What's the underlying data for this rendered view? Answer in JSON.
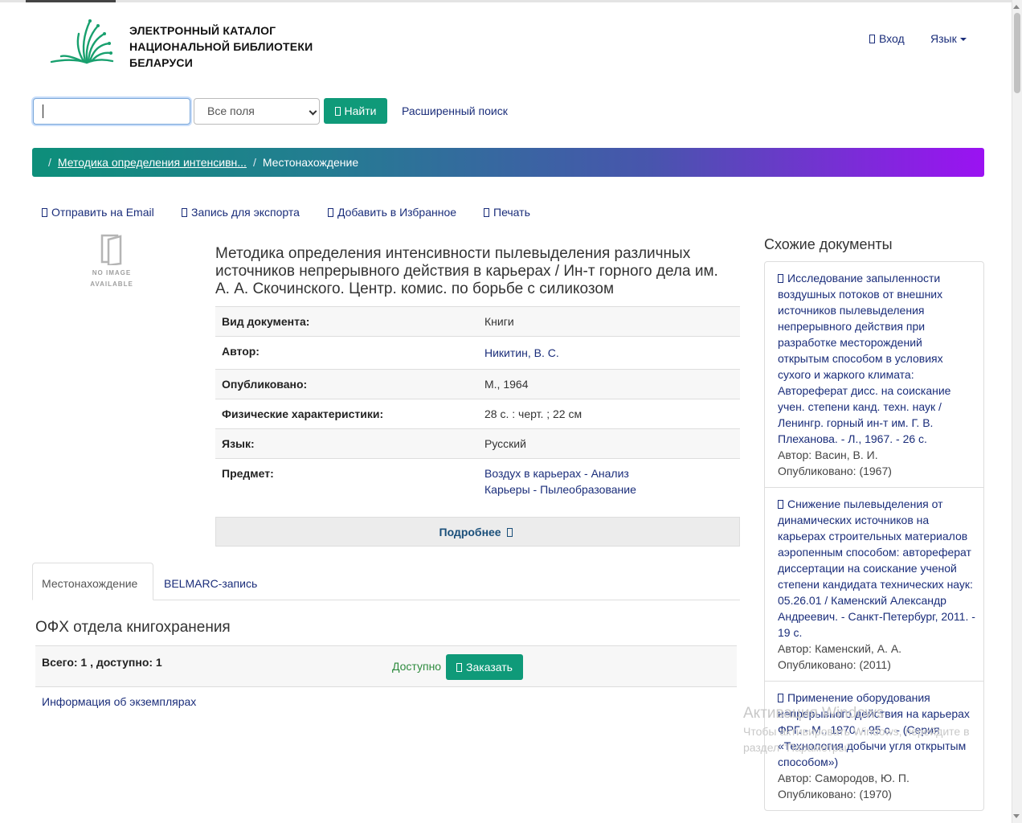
{
  "header": {
    "site_title_line1": "ЭЛЕКТРОННЫЙ КАТАЛОГ",
    "site_title_line2": "НАЦИОНАЛЬНОЙ БИБЛИОТЕКИ",
    "site_title_line3": "БЕЛАРУСИ",
    "login_label": "Вход",
    "language_label": "Язык"
  },
  "search": {
    "query": "",
    "field_select": "Все поля",
    "find_label": "Найти",
    "advanced_label": "Расширенный поиск"
  },
  "breadcrumb": {
    "record_link": "Методика определения интенсивн...",
    "current": "Местонахождение"
  },
  "actions": {
    "email": "Отправить на Email",
    "export": "Запись для экспорта",
    "favorites": "Добавить в Избранное",
    "print": "Печать"
  },
  "no_image": {
    "line1": "NO IMAGE",
    "line2": "AVAILABLE"
  },
  "record": {
    "title": "Методика определения интенсивности пылевыделения различных источников непрерывного действия в карьерах / Ин-т горного дела им. А. А. Скочинского. Центр. комис. по борьбе с силикозом",
    "fields": [
      {
        "label": "Вид документа:",
        "value": "Книги"
      },
      {
        "label": "Автор:",
        "value": "Никитин, В. С."
      },
      {
        "label": "Опубликовано:",
        "value": "М., 1964"
      },
      {
        "label": "Физические характеристики:",
        "value": "28 с. : черт. ; 22 см"
      },
      {
        "label": "Язык:",
        "value": "Русский"
      },
      {
        "label": "Предмет:",
        "values": [
          "Воздух в карьерах - Анализ",
          "Карьеры - Пылеобразование"
        ]
      }
    ],
    "more_label": "Подробнее"
  },
  "tabs": {
    "location": "Местонахождение",
    "belmarc": "BELMARC-запись"
  },
  "holdings": {
    "location_title": "ОФХ отдела книгохранения",
    "total": "Всего: 1 , доступно: 1",
    "status": "Доступно",
    "order_label": "Заказать",
    "copies_info": "Информация об экземплярах"
  },
  "similar": {
    "title": "Схожие документы",
    "items": [
      {
        "text": "Исследование запыленности воздушных потоков от внешних источников пылевыделения непрерывного действия при разработке месторождений открытым способом в условиях сухого и жаркого климата: Автореферат дисс. на соискание учен. степени канд. техн. наук / Ленингр. горный ин-т им. Г. В. Плеханова. - Л., 1967. - 26 с.",
        "author": "Автор: Васин, В. И.",
        "published": "Опубликовано: (1967)"
      },
      {
        "text": "Снижение пылевыделения от динамических источников на карьерах строительных материалов аэропенным способом: автореферат диссертации на соискание ученой степени кандидата технических наук: 05.26.01 / Каменский Александр Андреевич. - Санкт-Петербург, 2011. - 19 с.",
        "author": "Автор: Каменский, А. А.",
        "published": "Опубликовано: (2011)"
      },
      {
        "text": "Применение оборудования непрерывного действия на карьерах ФРГ. - М., 1970. - 95 с. - (Серия «Технология добычи угля открытым способом»)",
        "author": "Автор: Самородов, Ю. П.",
        "published": "Опубликовано: (1970)"
      }
    ]
  },
  "watermark": {
    "line1": "Активация Windows",
    "line2": "Чтобы активировать Windows, перейдите в",
    "line3": "раздел \"Параметры\"."
  },
  "colors": {
    "accent_green": "#0f9a79",
    "link_blue": "#1a2d7a",
    "gradient_start": "#0d8f7a",
    "gradient_end": "#9b12f2"
  }
}
